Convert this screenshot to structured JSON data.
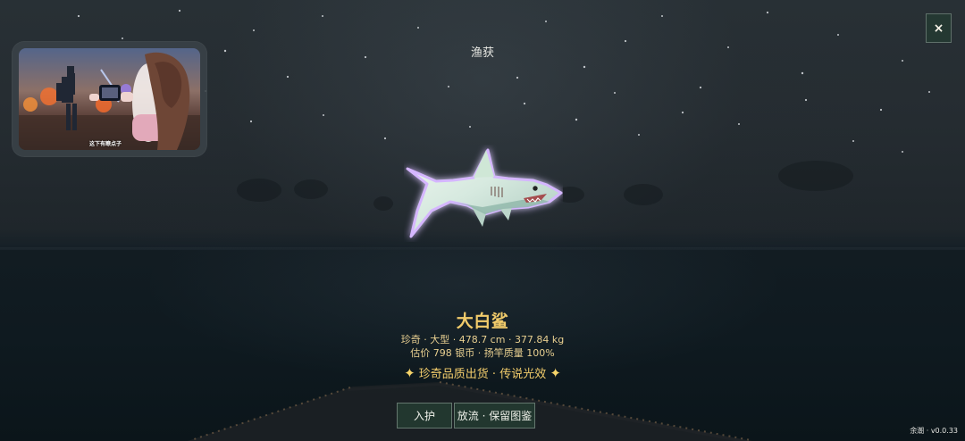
{
  "hud": {
    "close_icon": "×",
    "title": "渔获",
    "video_caption": "这下有瞭点子",
    "version": "余潮 · v0.0.33"
  },
  "catch": {
    "name": "大白鲨",
    "details_line1": "珍奇 · 大型 · 478.7 cm · 377.84 kg",
    "details_line2": "估价 798 银币 · 扬竿质量 100%",
    "rarity_label": "珍奇品质出货 · 传说光效",
    "spark_left": "✦",
    "spark_right": "✦"
  },
  "actions": {
    "keep_label": "入护",
    "release_label": "放流 · 保留图鉴"
  },
  "colors": {
    "accent": "#f2cc6b",
    "panel_green": "#23493a"
  },
  "icons": {
    "close": "close-icon",
    "rarity": "sparkle-icon",
    "catch": "shark-icon"
  }
}
